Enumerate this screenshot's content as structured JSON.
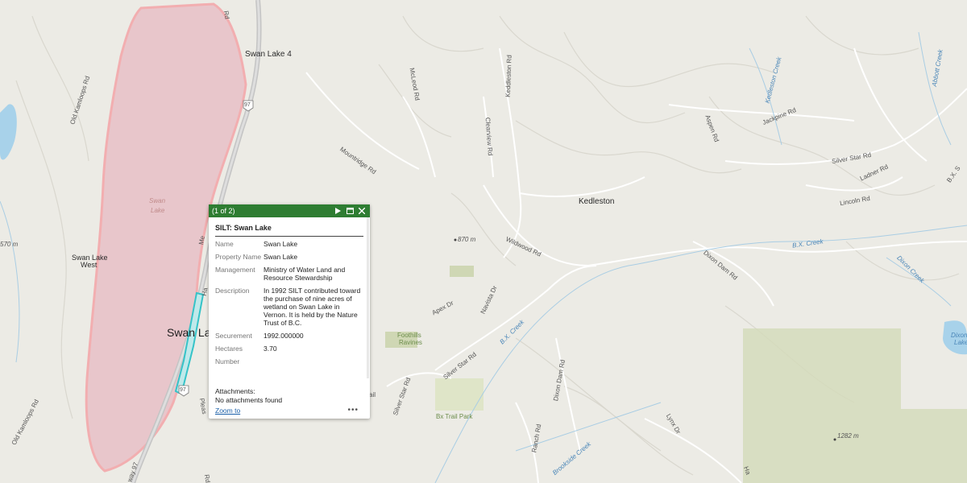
{
  "map": {
    "colors": {
      "land": "#ecebe5",
      "lake_fill": "#e8c6cb",
      "lake_edge": "#f2aeb0",
      "highway": "#c9c9c9",
      "stream": "#9cc3dd",
      "park": "#cfd7b4",
      "selection": "#35c3c8"
    },
    "labels": {
      "swan_lake_4": "Swan Lake 4",
      "swan_lake_west_1": "Swan Lake",
      "swan_lake_west_2": "West",
      "swan_lake_big": "Swan La",
      "lake_name_1": "Swan",
      "lake_name_2": "Lake",
      "kedleston": "Kedleston",
      "dixon_lake_1": "Dixon",
      "dixon_lake_2": "Lake",
      "foothills_1": "Foothills",
      "foothills_2": "Ravines",
      "bx_trail_park": "Bx Trail Park",
      "elev_870": "870 m",
      "elev_570": "570 m",
      "elev_1282": "1282 m",
      "shield_97_top": "97",
      "shield_97_bottom": "97",
      "highway_97": "way 97",
      "mcleod_rd": "McLeod Rd",
      "mountridge_rd": "Mountridge Rd",
      "kedlestone_rd": "Keddleston Rd",
      "clearview_rd": "Clearview Rd",
      "aspen_rd": "Aspen Rd",
      "jackpine_rd": "Jackpine Rd",
      "silver_star_rd_ne": "Silver Star Rd",
      "ladner_rd": "Ladner Rd",
      "lincoln_rd": "Lincoln Rd",
      "wildwood_rd": "Wildwood Rd",
      "dixon_dam_rd_1": "Dixon Dam Rd",
      "dixon_dam_rd_2": "Dixon Dam Rd",
      "navista_dr": "Navista Dr",
      "apex_dr": "Apex Dr",
      "silver_star_rd_mid": "Silver Star Rd",
      "silver_star_rd_sw": "Silver Star Rd",
      "ranch_rd": "Ranch Rd",
      "brookside_creek": "Brookside Creek",
      "lynx_dr": "Lynx Dr",
      "kedleston_creek": "Kedleston Creek",
      "abbott_creek": "Abbott Creek",
      "bx_creek_1": "B.X. Creek",
      "bx_creek_2": "B.X. Creek",
      "dixon_creek": "Dixon Creek",
      "old_kamloops_rd_1": "Old Kamloops Rd",
      "old_kamloops_rd_2": "Old Kamloops Rd",
      "rd_top": "Rd",
      "ha_frag": "Ha",
      "me_frag": "Me",
      "pleas_frag": "Pleas",
      "rd_bottom": "Rd",
      "bx_sr": "B.X. S",
      "trail_frag": "ail",
      "ha_bottom": "Ha"
    }
  },
  "popup": {
    "counter": "(1 of 2)",
    "title": "SILT: Swan Lake",
    "fields": [
      {
        "label": "Name",
        "value": "Swan Lake"
      },
      {
        "label": "Property Name",
        "value": "Swan Lake"
      },
      {
        "label": "Management",
        "value": "Ministry of Water Land and Resource Stewardship"
      },
      {
        "label": "Description",
        "value": "In 1992 SILT contributed toward the purchase of nine acres of wetland on Swan Lake in Vernon. It is held by the Nature Trust of B.C."
      },
      {
        "label": "Securement",
        "value": "1992.000000"
      },
      {
        "label": "Hectares",
        "value": "3.70"
      },
      {
        "label": "Number",
        "value": ""
      }
    ],
    "attachments_label": "Attachments:",
    "attachments_value": "No attachments found",
    "zoom_to": "Zoom to",
    "more": "•••",
    "header_color": "#2e7d32"
  }
}
